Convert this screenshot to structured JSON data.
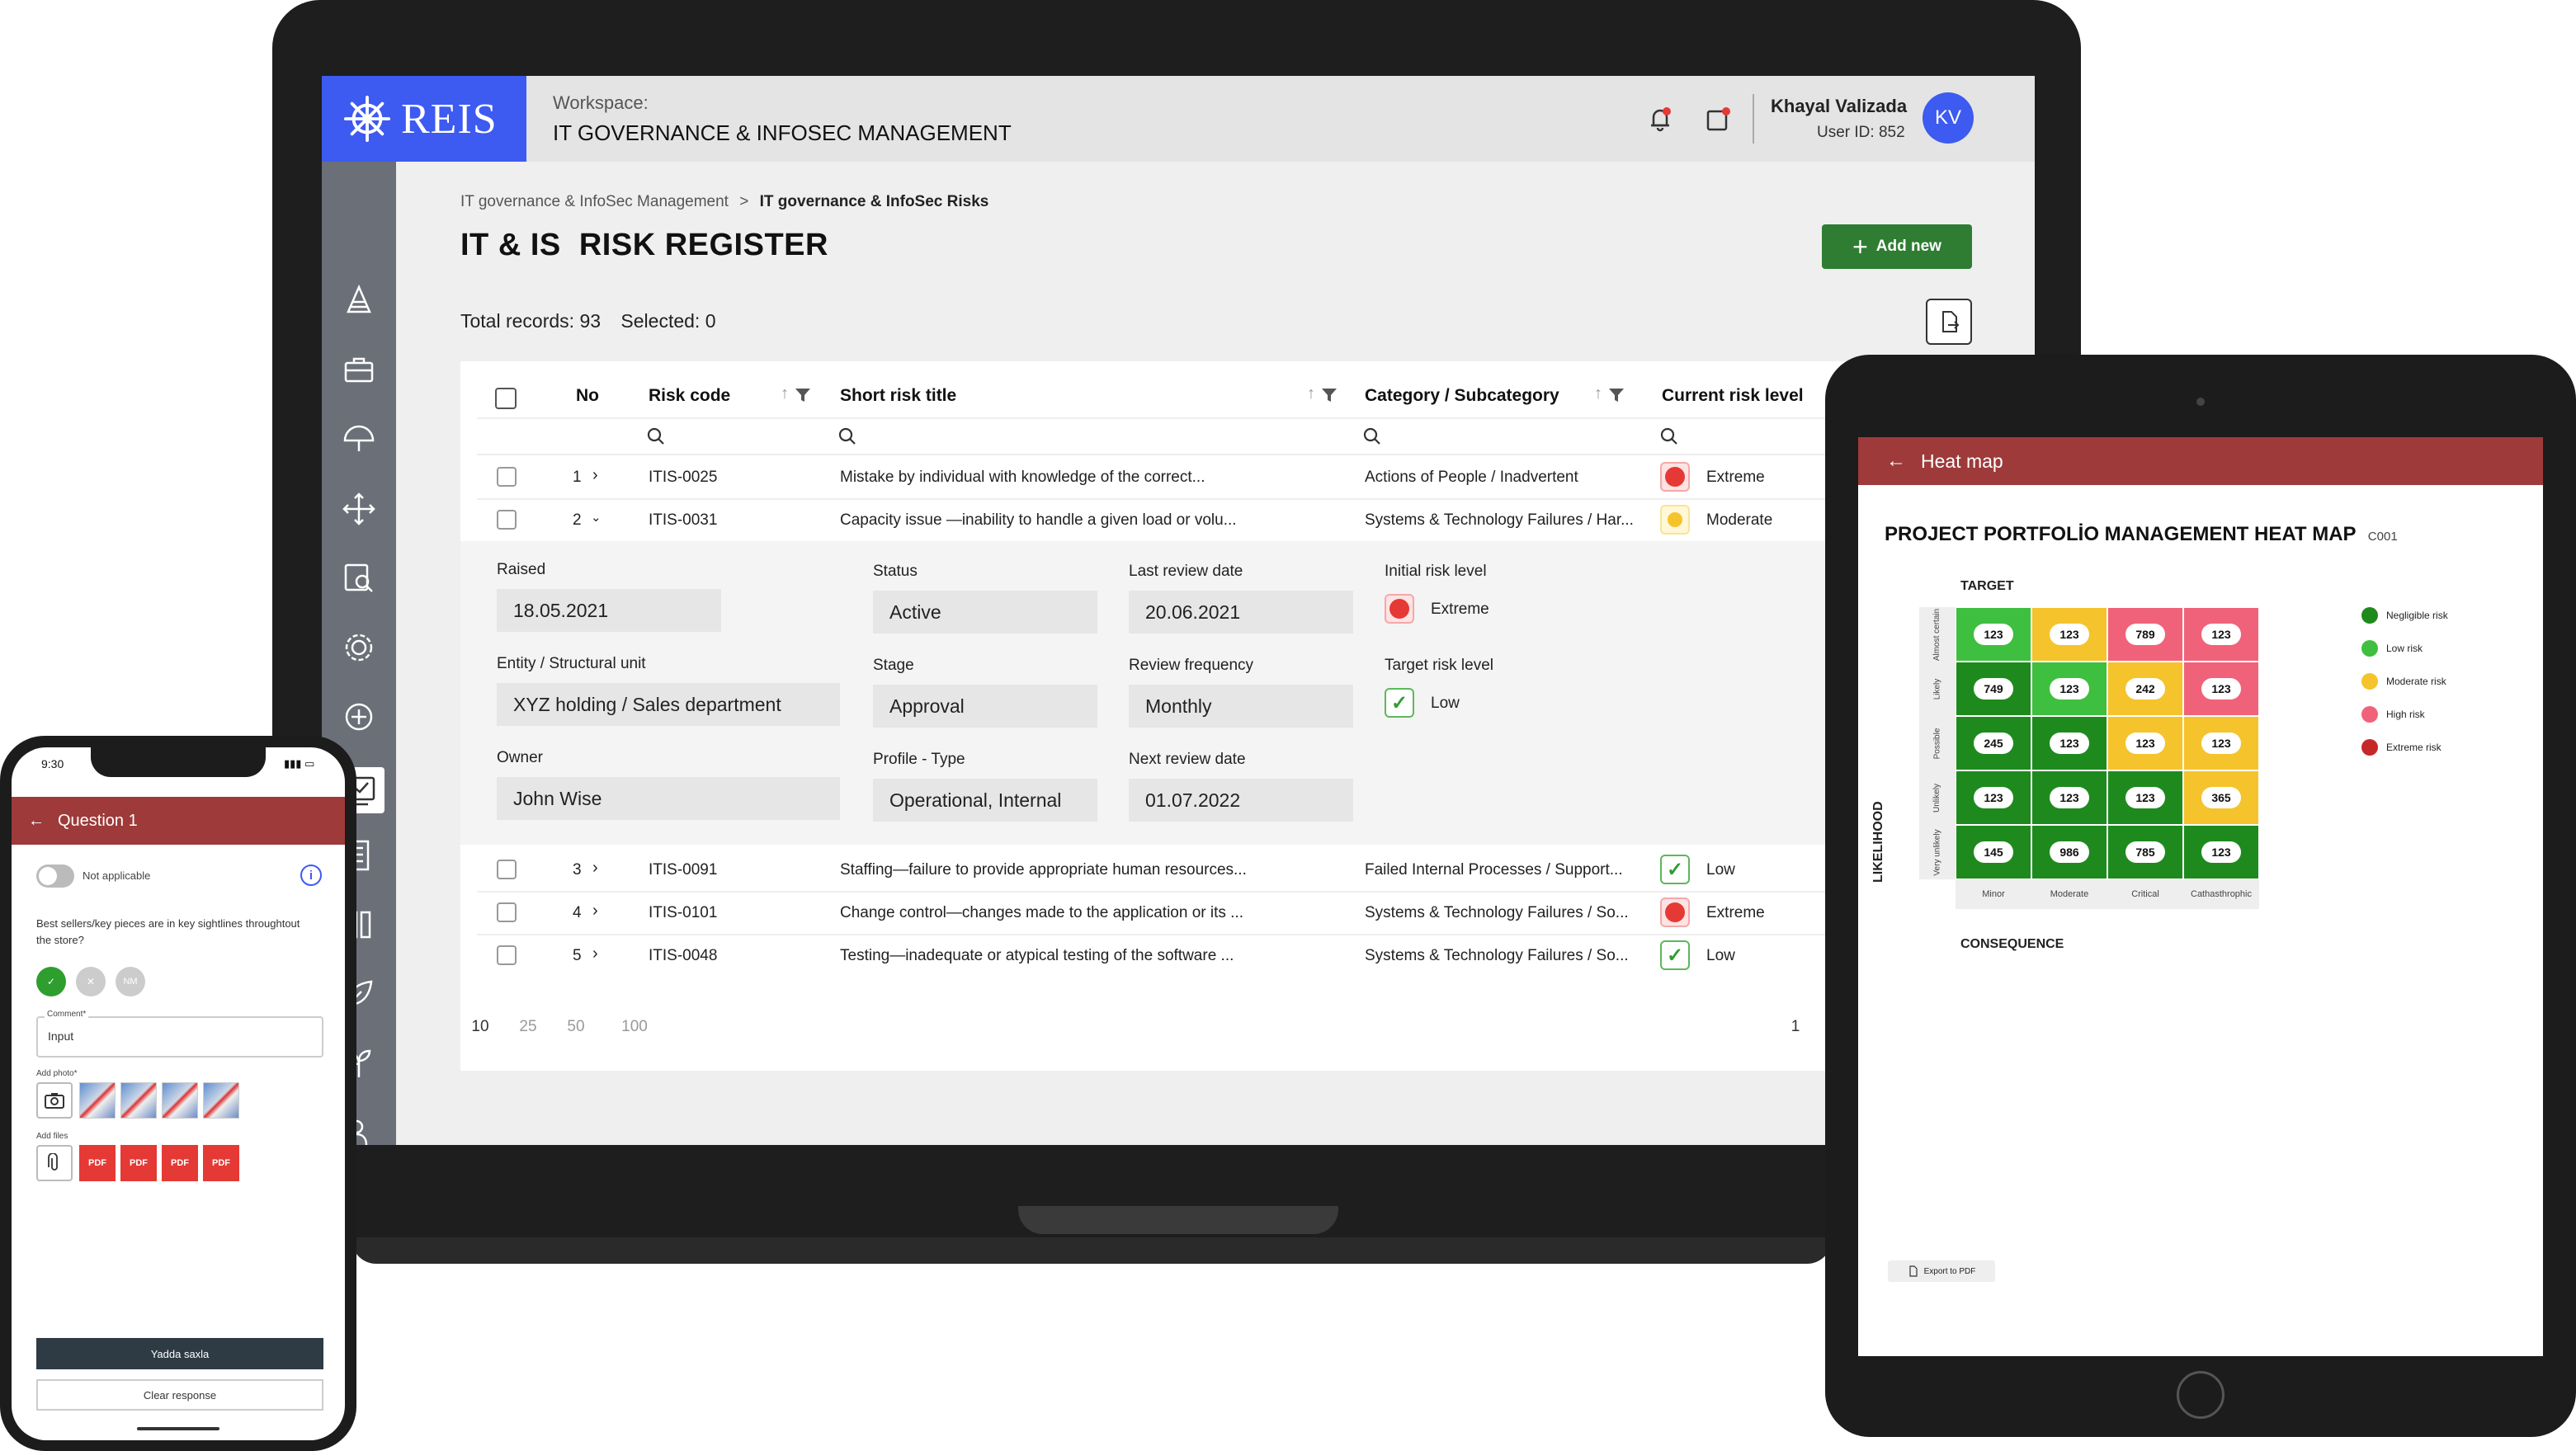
{
  "laptop": {
    "logo": "REIS",
    "workspace_label": "Workspace:",
    "workspace_name": "IT GOVERNANCE & INFOSEC MANAGEMENT",
    "user_name": "Khayal Valizada",
    "user_id": "User ID: 852",
    "avatar": "KV",
    "breadcrumb": {
      "parent": "IT governance & InfoSec Management",
      "separator": ">",
      "current": "IT governance & InfoSec Risks"
    },
    "page_title": "IT & IS  RISK REGISTER",
    "add_new_label": "Add new",
    "totals": {
      "total": "Total records: 93",
      "selected": "Selected: 0"
    },
    "columns": {
      "no": "No",
      "risk_code": "Risk code",
      "short_title": "Short risk title",
      "category": "Category / Subcategory",
      "current_level": "Current risk level"
    },
    "rows": [
      {
        "no": "1",
        "code": "ITIS-0025",
        "title": "Mistake by individual with knowledge of the correct...",
        "category": "Actions of People / Inadvertent",
        "level": "Extreme"
      },
      {
        "no": "2",
        "code": "ITIS-0031",
        "title": "Capacity issue —inability to handle a given load or volu...",
        "category": "Systems & Technology Failures / Har...",
        "level": "Moderate"
      },
      {
        "no": "3",
        "code": "ITIS-0091",
        "title": "Staffing—failure to provide appropriate human resources...",
        "category": "Failed Internal Processes / Support...",
        "level": "Low"
      },
      {
        "no": "4",
        "code": "ITIS-0101",
        "title": "Change control—changes made to the application or its ...",
        "category": "Systems & Technology Failures / So...",
        "level": "Extreme"
      },
      {
        "no": "5",
        "code": "ITIS-0048",
        "title": "Testing—inadequate or atypical testing of the software ...",
        "category": "Systems & Technology Failures / So...",
        "level": "Low"
      }
    ],
    "detail": {
      "raised_label": "Raised",
      "raised": "18.05.2021",
      "status_label": "Status",
      "status": "Active",
      "last_review_label": "Last review date",
      "last_review": "20.06.2021",
      "initial_level_label": "Initial risk level",
      "initial_level": "Extreme",
      "entity_label": "Entity / Structural unit",
      "entity": "XYZ holding / Sales department",
      "stage_label": "Stage",
      "stage": "Approval",
      "frequency_label": "Review frequency",
      "frequency": "Monthly",
      "target_level_label": "Target risk level",
      "target_level": "Low",
      "owner_label": "Owner",
      "owner": "John Wise",
      "profile_label": "Profile - Type",
      "profile": "Operational, Internal",
      "next_review_label": "Next review date",
      "next_review": "01.07.2022"
    },
    "page_sizes": [
      "10",
      "25",
      "50",
      "100"
    ],
    "current_page": "1",
    "colors": {
      "brand": "#3d5af1",
      "add_button": "#2e7d32",
      "sidebar": "#6b6f78"
    }
  },
  "tablet": {
    "header_title": "Heat map",
    "title": "PROJECT PORTFOLİO MANAGEMENT HEAT MAP",
    "code": "C001",
    "target_label": "TARGET",
    "consequence_label": "CONSEQUENCE",
    "likelihood_label": "LIKELIHOOD",
    "row_labels": [
      "Almost certain",
      "Likely",
      "Possible",
      "Unlikely",
      "Very unlikely"
    ],
    "col_labels": [
      "Minor",
      "Moderate",
      "Critical",
      "Cathasthrophic"
    ],
    "grid": [
      [
        {
          "v": "123",
          "c": "#3fbf3f"
        },
        {
          "v": "123",
          "c": "#f5c32c"
        },
        {
          "v": "789",
          "c": "#f0627a"
        },
        {
          "v": "123",
          "c": "#f0627a"
        }
      ],
      [
        {
          "v": "749",
          "c": "#1e8a1e"
        },
        {
          "v": "123",
          "c": "#3fbf3f"
        },
        {
          "v": "242",
          "c": "#f5c32c"
        },
        {
          "v": "123",
          "c": "#f0627a"
        }
      ],
      [
        {
          "v": "245",
          "c": "#1e8a1e"
        },
        {
          "v": "123",
          "c": "#1e8a1e"
        },
        {
          "v": "123",
          "c": "#f5c32c"
        },
        {
          "v": "123",
          "c": "#f5c32c"
        }
      ],
      [
        {
          "v": "123",
          "c": "#1e8a1e"
        },
        {
          "v": "123",
          "c": "#1e8a1e"
        },
        {
          "v": "123",
          "c": "#1e8a1e"
        },
        {
          "v": "365",
          "c": "#f5c32c"
        }
      ],
      [
        {
          "v": "145",
          "c": "#1e8a1e"
        },
        {
          "v": "986",
          "c": "#1e8a1e"
        },
        {
          "v": "785",
          "c": "#1e8a1e"
        },
        {
          "v": "123",
          "c": "#1e8a1e"
        }
      ]
    ],
    "legend": [
      {
        "label": "Negligible risk",
        "color": "#1e8a1e"
      },
      {
        "label": "Low risk",
        "color": "#3fbf3f"
      },
      {
        "label": "Moderate risk",
        "color": "#f5c32c"
      },
      {
        "label": "High risk",
        "color": "#f0627a"
      },
      {
        "label": "Extreme risk",
        "color": "#c62828"
      }
    ],
    "export_label": "Export to PDF",
    "header_color": "#9e3a3a"
  },
  "phone": {
    "time": "9:30",
    "header_title": "Question 1",
    "not_applicable": "Not applicable",
    "question": "Best sellers/key pieces are in key sightlines throughtout the store?",
    "answers": [
      "✓",
      "✕",
      "NM"
    ],
    "comment_label": "Comment*",
    "comment_value": "Input",
    "add_photo_label": "Add photo*",
    "add_files_label": "Add files",
    "pdf_label": "PDF",
    "save_label": "Yadda saxla",
    "clear_label": "Clear response"
  }
}
